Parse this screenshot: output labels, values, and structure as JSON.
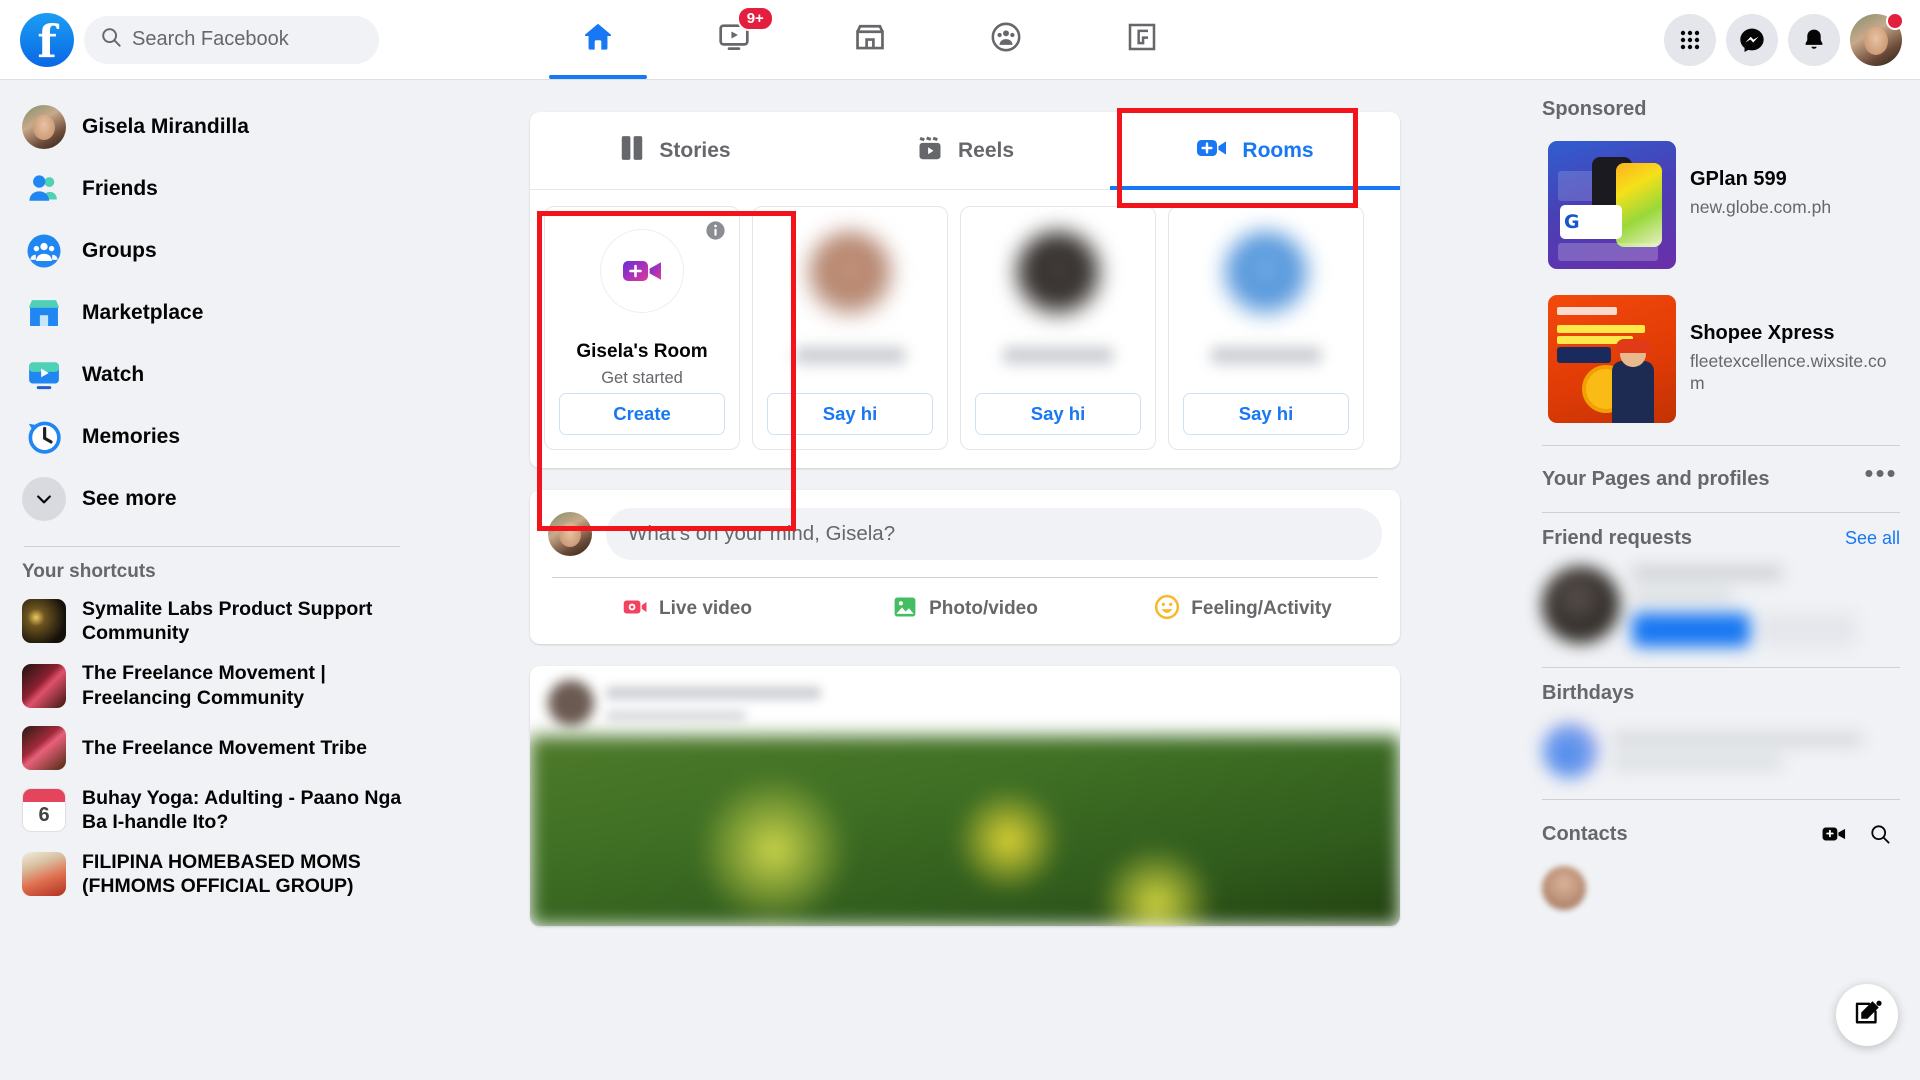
{
  "header": {
    "logo_icon": "facebook-logo",
    "search": {
      "placeholder": "Search Facebook",
      "value": "",
      "icon": "search-icon"
    },
    "nav": [
      {
        "name": "home",
        "icon": "home-icon",
        "active": true,
        "badge": ""
      },
      {
        "name": "video",
        "icon": "video-icon",
        "active": false,
        "badge": "9+"
      },
      {
        "name": "marketplace",
        "icon": "marketplace-icon",
        "active": false,
        "badge": ""
      },
      {
        "name": "groups",
        "icon": "groups-icon",
        "active": false,
        "badge": ""
      },
      {
        "name": "gaming",
        "icon": "gaming-icon",
        "active": false,
        "badge": ""
      }
    ],
    "actions": [
      {
        "name": "menu",
        "icon": "grid-menu-icon"
      },
      {
        "name": "messenger",
        "icon": "messenger-icon"
      },
      {
        "name": "notifications",
        "icon": "bell-icon"
      }
    ],
    "account": {
      "name": "account-avatar",
      "has_notification_dot": true
    }
  },
  "sidebar": {
    "items": [
      {
        "label": "Gisela Mirandilla",
        "icon": "profile-avatar"
      },
      {
        "label": "Friends",
        "icon": "friends-icon"
      },
      {
        "label": "Groups",
        "icon": "groups-icon"
      },
      {
        "label": "Marketplace",
        "icon": "marketplace-icon"
      },
      {
        "label": "Watch",
        "icon": "watch-icon"
      },
      {
        "label": "Memories",
        "icon": "memories-icon"
      },
      {
        "label": "See more",
        "icon": "chevron-down-icon"
      }
    ],
    "shortcuts_title": "Your shortcuts",
    "shortcuts": [
      {
        "label": "Symalite Labs Product Support Community",
        "thumb": "th-symalite"
      },
      {
        "label": "The Freelance Movement | Freelancing Community",
        "thumb": "th-freelance"
      },
      {
        "label": "The Freelance Movement Tribe",
        "thumb": "th-tribe"
      },
      {
        "label": "Buhay Yoga: Adulting - Paano Nga Ba I-handle Ito?",
        "thumb": "th-cal",
        "day": "6"
      },
      {
        "label": "FILIPINA HOMEBASED MOMS (FHMOMS OFFICIAL GROUP)",
        "thumb": "th-filipina"
      }
    ]
  },
  "feed": {
    "rooms": {
      "tabs": [
        {
          "label": "Stories",
          "icon": "stories-icon",
          "active": false
        },
        {
          "label": "Reels",
          "icon": "reels-icon",
          "active": false
        },
        {
          "label": "Rooms",
          "icon": "rooms-icon",
          "active": true
        }
      ],
      "cards": [
        {
          "title": "Gisela's Room",
          "subtitle": "Get started",
          "button": "Create",
          "type": "create",
          "info_icon": "info-icon"
        },
        {
          "title": "",
          "subtitle": "",
          "button": "Say hi",
          "type": "contact",
          "avatar_tone": "a"
        },
        {
          "title": "",
          "subtitle": "",
          "button": "Say hi",
          "type": "contact",
          "avatar_tone": "b"
        },
        {
          "title": "",
          "subtitle": "",
          "button": "Say hi",
          "type": "contact",
          "avatar_tone": "c"
        }
      ]
    },
    "composer": {
      "placeholder": "What's on your mind, Gisela?",
      "value": "",
      "actions": [
        {
          "label": "Live video",
          "icon": "live-video-icon"
        },
        {
          "label": "Photo/video",
          "icon": "photo-video-icon"
        },
        {
          "label": "Feeling/Activity",
          "icon": "feeling-activity-icon"
        }
      ]
    }
  },
  "right_sidebar": {
    "sponsored_title": "Sponsored",
    "ads": [
      {
        "title": "GPlan 599",
        "url": "new.globe.com.ph",
        "thumb": "ad-gplan"
      },
      {
        "title": "Shopee Xpress",
        "url": "fleetexcellence.wixsite.com",
        "thumb": "ad-shopee"
      }
    ],
    "pages_title": "Your Pages and profiles",
    "pages_more_icon": "ellipsis-icon",
    "friend_requests_title": "Friend requests",
    "friend_requests_see_all": "See all",
    "birthdays_title": "Birthdays",
    "contacts_title": "Contacts",
    "contacts_icons": [
      {
        "name": "new-room-video-icon"
      },
      {
        "name": "search-contacts-icon"
      }
    ]
  },
  "floating": {
    "compose_icon": "compose-icon"
  },
  "annotations": [
    {
      "name": "rooms-tab-highlight",
      "color": "#f3131b"
    },
    {
      "name": "room-card-highlight",
      "color": "#f3131b"
    }
  ]
}
